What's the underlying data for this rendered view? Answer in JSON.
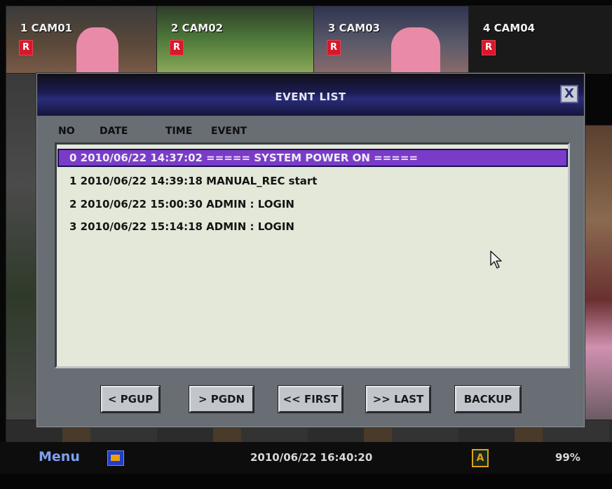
{
  "cameras": [
    {
      "label": "1 CAM01",
      "rec_badge": "R"
    },
    {
      "label": "2 CAM02",
      "rec_badge": "R"
    },
    {
      "label": "3 CAM03",
      "rec_badge": "R"
    },
    {
      "label": "4 CAM04",
      "rec_badge": "R"
    }
  ],
  "dialog": {
    "title": "EVENT LIST",
    "close_label": "X",
    "columns": {
      "no": "NO",
      "date": "DATE",
      "time": "TIME",
      "event": "EVENT"
    },
    "rows": [
      {
        "text": "0 2010/06/22 14:37:02 ===== SYSTEM POWER ON =====",
        "selected": true
      },
      {
        "text": "1 2010/06/22 14:39:18 MANUAL_REC start",
        "selected": false
      },
      {
        "text": "2 2010/06/22 15:00:30 ADMIN : LOGIN",
        "selected": false
      },
      {
        "text": "3 2010/06/22 15:14:18 ADMIN : LOGIN",
        "selected": false
      }
    ],
    "buttons": {
      "pgup": "< PGUP",
      "pgdn": "> PGDN",
      "first": "<< FIRST",
      "last": ">> LAST",
      "backup": "BACKUP"
    }
  },
  "status_bar": {
    "menu_label": "Menu",
    "hdd_icon": "hdd-icon",
    "datetime": "2010/06/22 16:40:20",
    "alarm_badge": "A",
    "disk_percent": "99%"
  },
  "colors": {
    "selected_row": "#7a3cc8",
    "header_blue": "#2a2c7a",
    "rec_red": "#d8182a",
    "menu_blue": "#7fa0f0"
  }
}
